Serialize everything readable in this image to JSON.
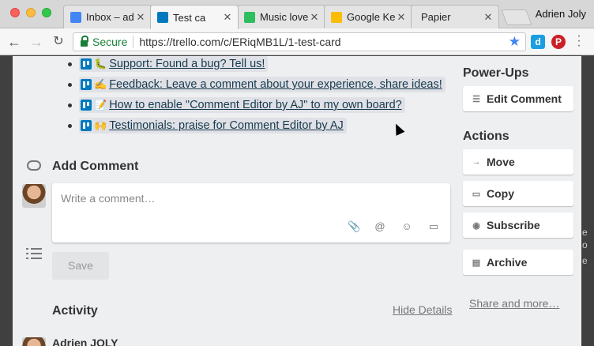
{
  "browser": {
    "user": "Adrien Joly",
    "tabs": [
      {
        "label": "Inbox – ad",
        "icon": "inbox-icon",
        "color": "#4285f4"
      },
      {
        "label": "Test ca",
        "icon": "trello-icon",
        "color": "#0079bf",
        "active": true
      },
      {
        "label": "Music love",
        "icon": "evernote-icon",
        "color": "#2dbe60"
      },
      {
        "label": "Google Ke",
        "icon": "keep-icon",
        "color": "#fbbc05"
      },
      {
        "label": "Papier",
        "icon": "",
        "color": "#ffffff"
      }
    ],
    "secure_label": "Secure",
    "url": "https://trello.com/c/ERiqMB1L/1-test-card",
    "extensions": [
      "d",
      "P"
    ]
  },
  "checklist": [
    {
      "emoji": "🐛",
      "text": "Support: Found a bug? Tell us!"
    },
    {
      "emoji": "✍️",
      "text": "Feedback: Leave a comment about your experience, share ideas!"
    },
    {
      "emoji": "📝",
      "text": "How to enable \"Comment Editor by AJ\" to my own board?"
    },
    {
      "emoji": "🙌",
      "text": "Testimonials: praise for Comment Editor by AJ"
    }
  ],
  "comment": {
    "title": "Add Comment",
    "placeholder": "Write a comment…",
    "save_label": "Save"
  },
  "activity": {
    "title": "Activity",
    "hide_details": "Hide Details",
    "user": "Adrien JOLY"
  },
  "sidebar": {
    "powerups_title": "Power-Ups",
    "powerups": [
      {
        "label": "Edit Comment",
        "icon": "list-icon"
      }
    ],
    "actions_title": "Actions",
    "actions": [
      {
        "label": "Move",
        "icon": "arrow-right-icon"
      },
      {
        "label": "Copy",
        "icon": "card-icon"
      },
      {
        "label": "Subscribe",
        "icon": "eye-icon"
      },
      {
        "label": "Archive",
        "icon": "archive-icon"
      }
    ],
    "share_label": "Share and more…"
  },
  "background_edge": [
    "e",
    "o",
    "e"
  ]
}
